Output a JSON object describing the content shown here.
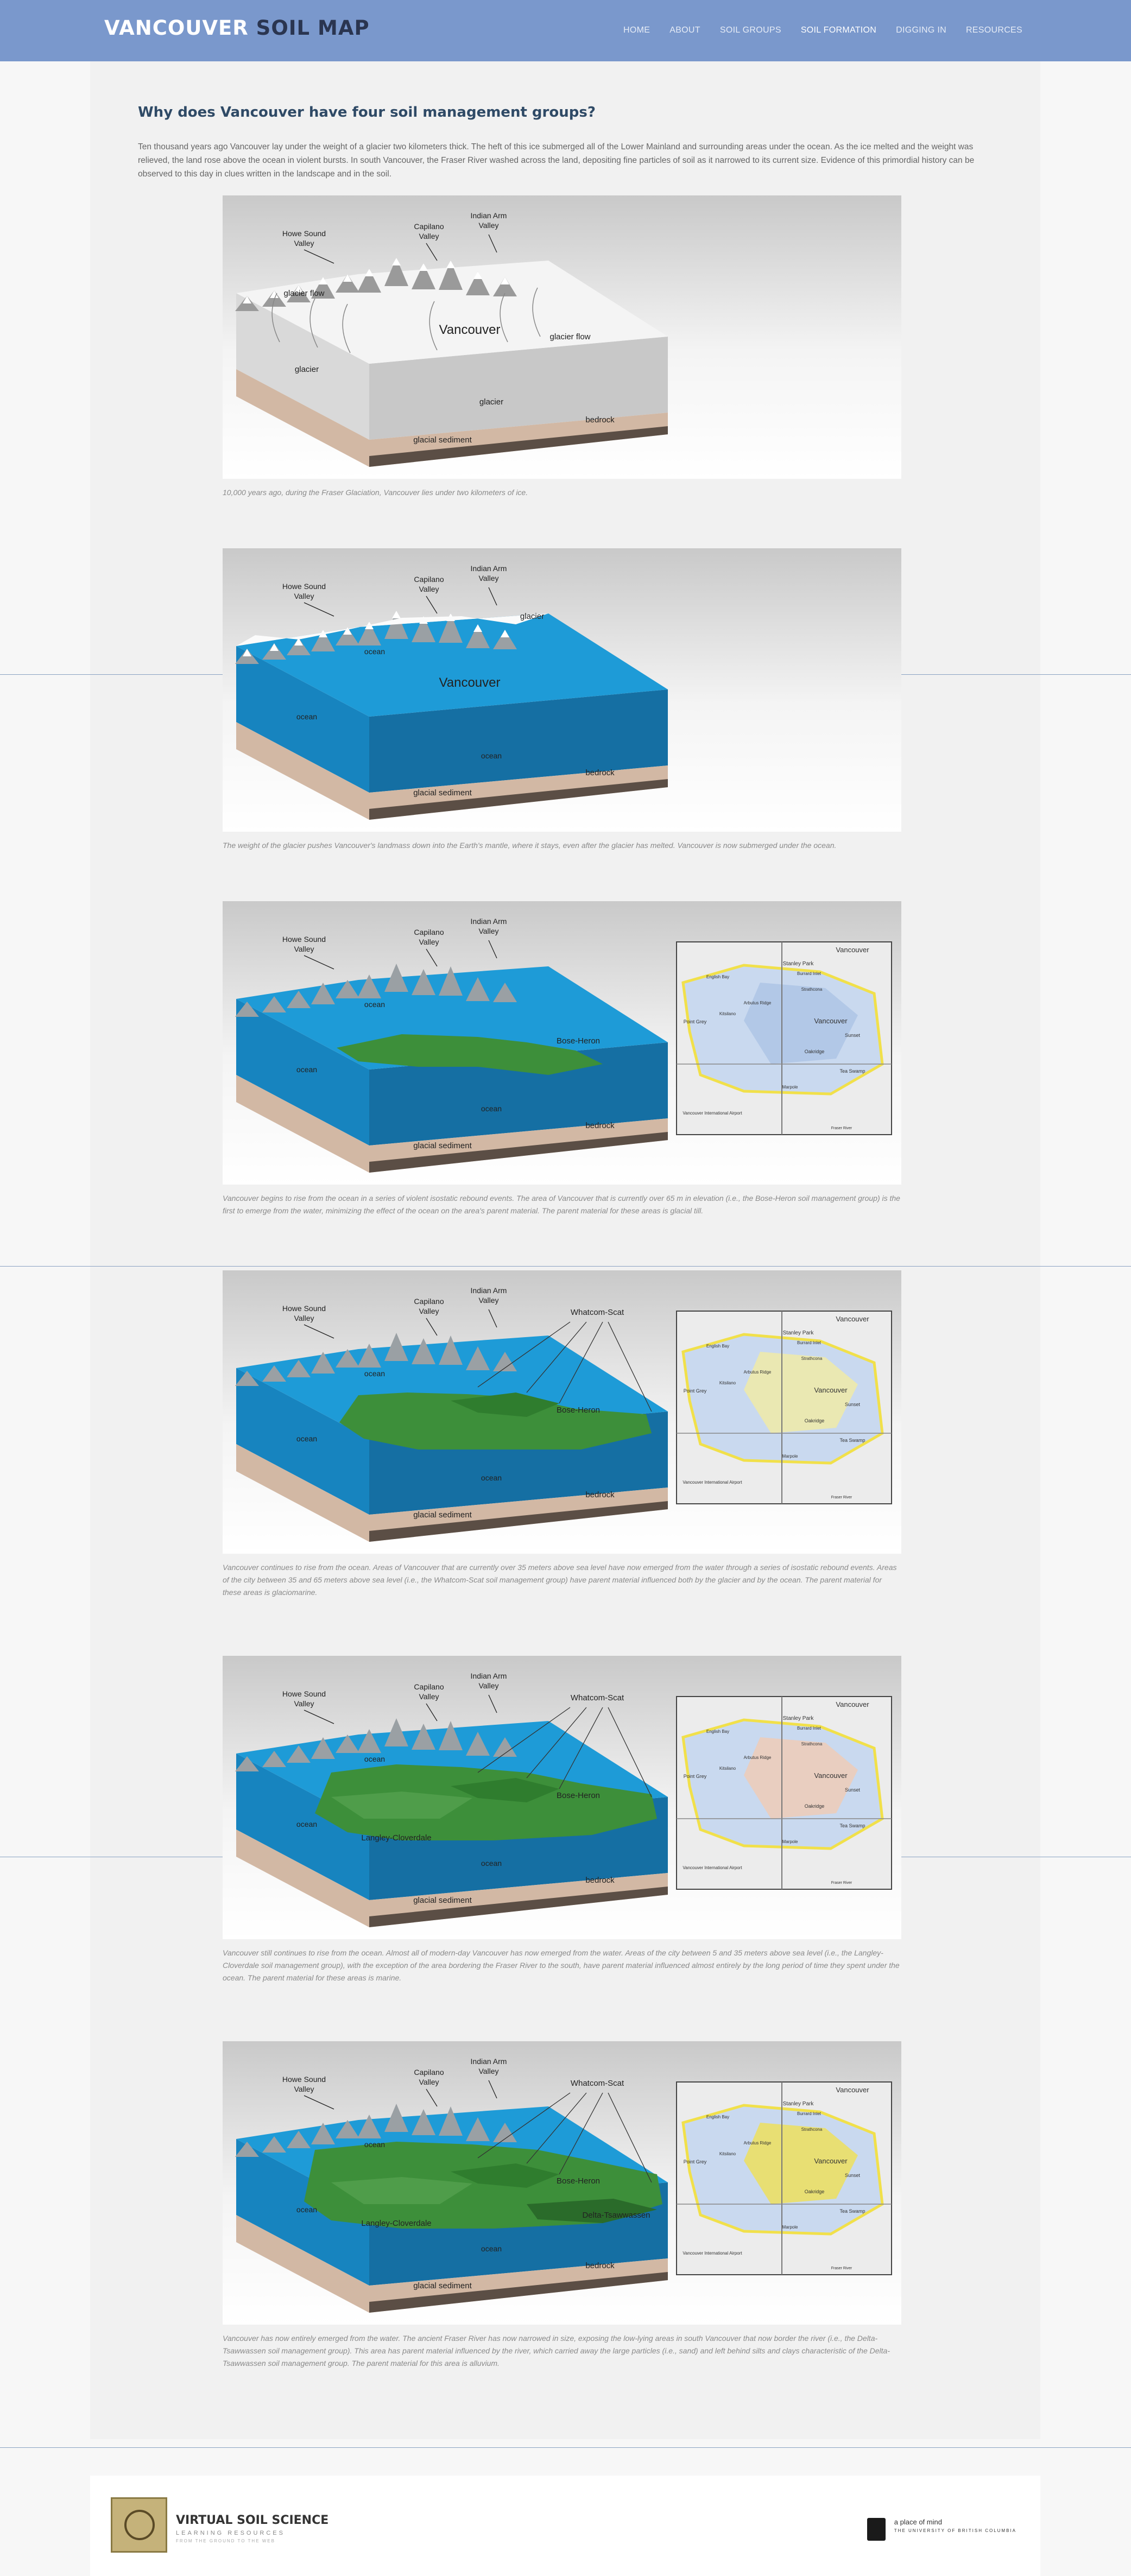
{
  "header": {
    "brand_part1": "VANCOUVER",
    "brand_part2": "SOIL MAP",
    "nav": [
      "HOME",
      "ABOUT",
      "SOIL GROUPS",
      "SOIL FORMATION",
      "DIGGING IN",
      "RESOURCES"
    ],
    "active_nav": "SOIL FORMATION"
  },
  "main": {
    "title": "Why does Vancouver have four soil management groups?",
    "intro": "Ten thousand years ago Vancouver lay under the weight of a glacier two kilometers thick. The heft of this ice submerged all of the Lower Mainland and surrounding areas under the ocean. As the ice melted and the weight was relieved, the land rose above the ocean in violent bursts. In south Vancouver, the Fraser River washed across the land, depositing fine particles of soil as it narrowed to its current size. Evidence of this primordial history can be observed to this day in clues written in the landscape and in the soil.",
    "figures": [
      {
        "stage": "glacier",
        "labels": {
          "howe": "Howe Sound Valley",
          "capilano": "Capilano Valley",
          "indian": "Indian Arm Valley",
          "flow1": "glacier flow",
          "flow2": "glacier flow",
          "city": "Vancouver",
          "left": "glacier",
          "front": "glacier",
          "sediment": "glacial sediment",
          "bedrock": "bedrock"
        },
        "caption": "10,000 years ago, during the Fraser Glaciation, Vancouver lies under two kilometers of ice."
      },
      {
        "stage": "submerged",
        "labels": {
          "howe": "Howe Sound Valley",
          "capilano": "Capilano Valley",
          "indian": "Indian Arm Valley",
          "glacier": "glacier",
          "ocean1": "ocean",
          "city": "Vancouver",
          "ocean2": "ocean",
          "ocean3": "ocean",
          "sediment": "glacial sediment",
          "bedrock": "bedrock"
        },
        "caption": "The weight of the glacier pushes Vancouver's landmass down into the Earth's mantle, where it stays, even after the glacier has melted. Vancouver is now submerged under the ocean."
      },
      {
        "stage": "bose",
        "labels": {
          "howe": "Howe Sound Valley",
          "capilano": "Capilano Valley",
          "indian": "Indian Arm Valley",
          "ocean1": "ocean",
          "ocean2": "ocean",
          "ocean3": "ocean",
          "bose": "Bose-Heron",
          "sediment": "glacial sediment",
          "bedrock": "bedrock"
        },
        "map": {
          "labels": [
            "Vancouver",
            "Stanley Park",
            "Burrard Inlet",
            "English Bay",
            "Strathcona",
            "Point Grey",
            "Arbutus Ridge",
            "Kitsilano",
            "Vancouver",
            "Oakridge",
            "Marpole",
            "Vancouver International Airport",
            "Fraser River",
            "Sunset",
            "Tea Swamp"
          ],
          "highlight": "Bose-Heron"
        },
        "caption": "Vancouver begins to rise from the ocean in a series of violent isostatic rebound events. The area of Vancouver that is currently over 65 m in elevation (i.e., the Bose-Heron soil management group) is the first to emerge from the water, minimizing the effect of the ocean on the area's parent material. The parent material for these areas is glacial till."
      },
      {
        "stage": "whatcom",
        "labels": {
          "howe": "Howe Sound Valley",
          "capilano": "Capilano Valley",
          "indian": "Indian Arm Valley",
          "whatcom": "Whatcom-Scat",
          "ocean1": "ocean",
          "ocean2": "ocean",
          "ocean3": "ocean",
          "bose": "Bose-Heron",
          "sediment": "glacial sediment",
          "bedrock": "bedrock"
        },
        "map": {
          "labels": [
            "Vancouver",
            "Stanley Park",
            "Burrard Inlet",
            "English Bay",
            "Strathcona",
            "Point Grey",
            "Arbutus Ridge",
            "Kitsilano",
            "Vancouver",
            "Oakridge",
            "Marpole",
            "Vancouver International Airport",
            "Fraser River",
            "Sunset",
            "Tea Swamp"
          ],
          "highlight": "Whatcom-Scat"
        },
        "caption": "Vancouver continues to rise from the ocean. Areas of Vancouver that are currently over 35 meters above sea level have now emerged from the water through a series of isostatic rebound events. Areas of the city between 35 and 65 meters above sea level (i.e., the Whatcom-Scat soil management group) have parent material influenced both by the glacier and by the ocean. The parent material for these areas is glaciomarine."
      },
      {
        "stage": "langley",
        "labels": {
          "howe": "Howe Sound Valley",
          "capilano": "Capilano Valley",
          "indian": "Indian Arm Valley",
          "whatcom": "Whatcom-Scat",
          "ocean1": "ocean",
          "ocean2": "ocean",
          "ocean3": "ocean",
          "bose": "Bose-Heron",
          "langley": "Langley-Cloverdale",
          "sediment": "glacial sediment",
          "bedrock": "bedrock"
        },
        "map": {
          "labels": [
            "Vancouver",
            "Stanley Park",
            "Burrard Inlet",
            "English Bay",
            "Strathcona",
            "Point Grey",
            "Arbutus Ridge",
            "Kitsilano",
            "Vancouver",
            "Oakridge",
            "Marpole",
            "Vancouver International Airport",
            "Fraser River",
            "Sunset",
            "Tea Swamp"
          ],
          "highlight": "Langley-Cloverdale"
        },
        "caption": "Vancouver still continues to rise from the ocean. Almost all of modern-day Vancouver has now emerged from the water. Areas of the city between 5 and 35 meters above sea level (i.e., the Langley-Cloverdale soil management group), with the exception of the area bordering the Fraser River to the south, have parent material influenced almost entirely by the long period of time they spent under the ocean. The parent material for these areas is marine."
      },
      {
        "stage": "delta",
        "labels": {
          "howe": "Howe Sound Valley",
          "capilano": "Capilano Valley",
          "indian": "Indian Arm Valley",
          "whatcom": "Whatcom-Scat",
          "ocean1": "ocean",
          "ocean2": "ocean",
          "ocean3": "ocean",
          "bose": "Bose-Heron",
          "langley": "Langley-Cloverdale",
          "delta": "Delta-Tsawwassen",
          "sediment": "glacial sediment",
          "bedrock": "bedrock"
        },
        "map": {
          "labels": [
            "Vancouver",
            "Stanley Park",
            "Burrard Inlet",
            "English Bay",
            "Strathcona",
            "Point Grey",
            "Arbutus Ridge",
            "Kitsilano",
            "Vancouver",
            "Oakridge",
            "Marpole",
            "Vancouver International Airport",
            "Fraser River",
            "Sunset",
            "Tea Swamp"
          ],
          "highlight": "Delta-Tsawwassen"
        },
        "caption": "Vancouver has now entirely emerged from the water. The ancient Fraser River has now narrowed in size, exposing the low-lying areas in south Vancouver that now border the river (i.e., the Delta-Tsawwassen soil management group). This area has parent material influenced by the river, which carried away the large particles (i.e., sand) and left behind silts and clays characteristic of the Delta-Tsawwassen soil management group. The parent material for this area is alluvium."
      }
    ]
  },
  "footer": {
    "vss_title": "VIRTUAL SOIL SCIENCE",
    "vss_sub": "LEARNING RESOURCES",
    "vss_tag": "FROM THE GROUND TO THE WEB",
    "ubc_tag": "a place of mind",
    "ubc_name": "THE UNIVERSITY OF BRITISH COLUMBIA"
  },
  "colors": {
    "header": "#7a98cc",
    "ocean": "#1e9bd7",
    "land_green": "#3d8f3a",
    "glacier": "#f4f4f4",
    "sediment": "#d2b8a4",
    "bedrock": "#5b4e45",
    "title": "#2f4a66"
  }
}
